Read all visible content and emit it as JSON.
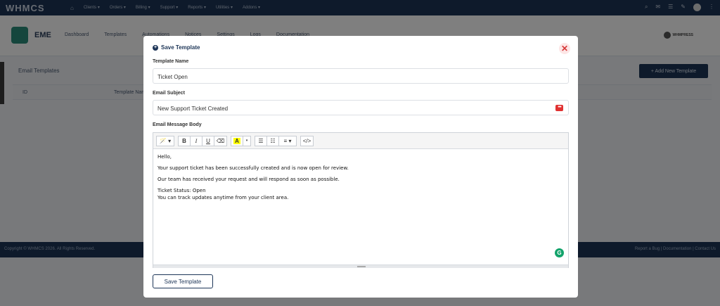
{
  "background": {
    "logo": "WHMCS",
    "nav": [
      "Clients ▾",
      "Orders ▾",
      "Billing ▾",
      "Support ▾",
      "Reports ▾",
      "Utilities ▾",
      "Addons ▾"
    ],
    "app_title": "EME",
    "subnav": [
      "Dashboard",
      "Templates",
      "Automations",
      "Notices",
      "Settings",
      "Logs",
      "Documentation"
    ],
    "brand": "WHMPRESS",
    "panel_title": "Email Templates",
    "add_button": "+ Add New Template",
    "table_headers": [
      "ID",
      "Template Name"
    ],
    "footer_left": "Copyright © WHMCS 2026. All Rights Reserved.",
    "footer_right": "Report a Bug | Documentation | Contact Us"
  },
  "modal": {
    "title": "Save Template",
    "close_glyph": "✕",
    "template_name": {
      "label": "Template Name",
      "value": "Ticket Open"
    },
    "email_subject": {
      "label": "Email Subject",
      "value": "New Support Ticket Created"
    },
    "body": {
      "label": "Email Message Body",
      "lines": [
        "Hello,",
        "Your support ticket has been successfully created and is now open for review.",
        "Our team has received your request and will respond as soon as possible.",
        "Ticket Status: Open",
        "You can track updates anytime from your client area."
      ]
    },
    "toolbar": {
      "style": "🪄 ▾",
      "bold": "B",
      "italic": "I",
      "underline": "U",
      "eraser": "⌫",
      "font_color": "A",
      "ul": "☰",
      "ol": "☷",
      "align": "≡ ▾",
      "code": "</>"
    },
    "save_button": "Save Template"
  },
  "colors": {
    "primary": "#1d3557",
    "danger": "#e03131",
    "grammarly": "#13a36b",
    "highlight": "#ffff00"
  }
}
